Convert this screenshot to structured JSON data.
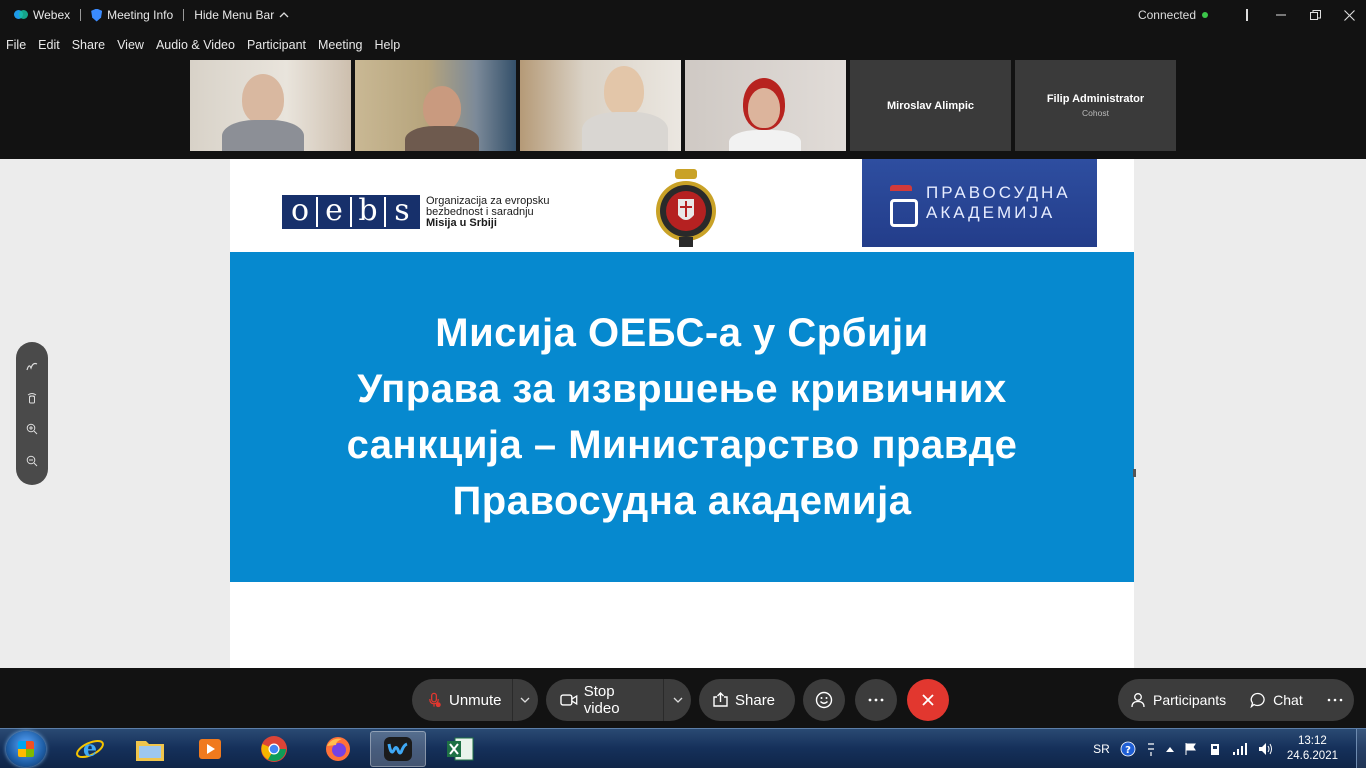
{
  "titlebar": {
    "app_name": "Webex",
    "meeting_info": "Meeting Info",
    "hide_menu_bar": "Hide Menu Bar",
    "status": "Connected"
  },
  "menu": {
    "items": [
      "File",
      "Edit",
      "Share",
      "View",
      "Audio & Video",
      "Participant",
      "Meeting",
      "Help"
    ]
  },
  "participants": {
    "named_tiles": [
      {
        "name": "Miroslav Alimpic",
        "role": ""
      },
      {
        "name": "Filip Administrator",
        "role": "Cohost"
      }
    ]
  },
  "slide": {
    "oebs_letters": [
      "o",
      "e",
      "b",
      "s"
    ],
    "oebs_text": [
      "Organizacija za evropsku",
      "bezbednost i saradnju",
      "Misija u Srbiji"
    ],
    "academy_text": [
      "ПРАВОСУДНА",
      "АКАДЕМИЈА"
    ],
    "lines": [
      "Мисија ОЕБС-а у Србији",
      "Управа за извршење кривичних",
      "санкција – Министарство правде",
      "Правосудна академија"
    ]
  },
  "controls": {
    "unmute": "Unmute",
    "stop_video": "Stop video",
    "share": "Share",
    "participants": "Participants",
    "chat": "Chat"
  },
  "taskbar": {
    "lang": "SR",
    "time": "13:12",
    "date": "24.6.2021"
  },
  "colors": {
    "slide_band": "#0689cf",
    "end_call": "#e2372f",
    "connected_dot": "#3cc64a"
  }
}
